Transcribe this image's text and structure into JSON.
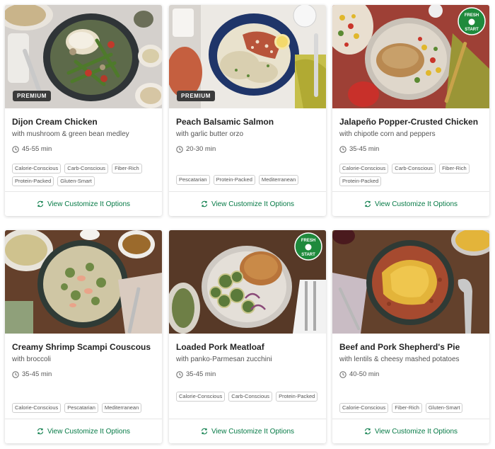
{
  "recipes": [
    {
      "title": "Dijon Cream Chicken",
      "subtitle": "with mushroom & green bean medley",
      "time": "45-55 min",
      "badge": "PREMIUM",
      "tags": [
        "Calorie-Conscious",
        "Carb-Conscious",
        "Fiber-Rich",
        "Protein-Packed",
        "Gluten-Smart"
      ],
      "link": "View Customize It Options"
    },
    {
      "title": "Peach Balsamic Salmon",
      "subtitle": "with garlic butter orzo",
      "time": "20-30 min",
      "badge": "PREMIUM",
      "tags": [
        "Pescatarian",
        "Protein-Packed",
        "Mediterranean"
      ],
      "link": "View Customize It Options"
    },
    {
      "title": "Jalapeño Popper-Crusted Chicken",
      "subtitle": "with chipotle corn and peppers",
      "time": "35-45 min",
      "badge_logo": "FRESH START",
      "tags": [
        "Calorie-Conscious",
        "Carb-Conscious",
        "Fiber-Rich",
        "Protein-Packed"
      ],
      "link": "View Customize It Options"
    },
    {
      "title": "Creamy Shrimp Scampi Couscous",
      "subtitle": "with broccoli",
      "time": "35-45 min",
      "tags": [
        "Calorie-Conscious",
        "Pescatarian",
        "Mediterranean"
      ],
      "link": "View Customize It Options"
    },
    {
      "title": "Loaded Pork Meatloaf",
      "subtitle": "with panko-Parmesan zucchini",
      "time": "35-45 min",
      "badge_logo": "FRESH START",
      "tags": [
        "Calorie-Conscious",
        "Carb-Conscious",
        "Protein-Packed"
      ],
      "link": "View Customize It Options"
    },
    {
      "title": "Beef and Pork Shepherd's Pie",
      "subtitle": "with lentils & cheesy mashed potatoes",
      "time": "40-50 min",
      "tags": [
        "Calorie-Conscious",
        "Fiber-Rich",
        "Gluten-Smart"
      ],
      "link": "View Customize It Options"
    }
  ],
  "colors": {
    "accent_green": "#067a46",
    "badge_dark": "#3b3b3b"
  },
  "icons": {
    "time": "clock-icon",
    "customize": "swap-arrows-icon",
    "fresh_start": "fresh-start-logo"
  }
}
